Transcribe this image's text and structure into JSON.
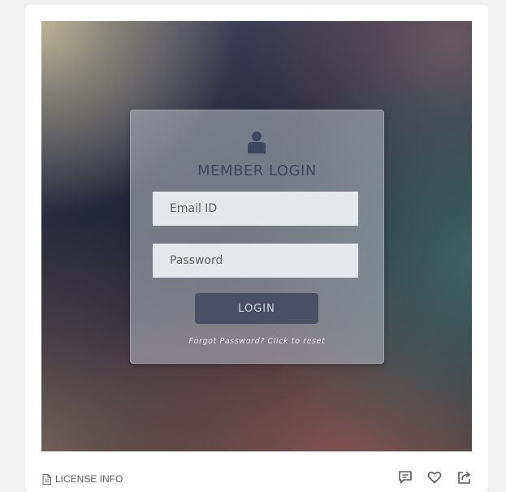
{
  "preview": {
    "panel": {
      "title": "MEMBER LOGIN",
      "email_placeholder": "Email ID",
      "password_placeholder": "Password",
      "login_label": "LOGIN",
      "forgot_text": "Forgot Password? Click to reset"
    }
  },
  "footer": {
    "license_label": "LICENSE INFO",
    "icons": [
      "comment-icon",
      "heart-icon",
      "share-icon"
    ]
  },
  "colors": {
    "panel_title": "#3f4660",
    "login_button": "#4c4e63",
    "field_bg": "#e6e7ea",
    "footer_text": "#5c5c5c",
    "footer_icon": "#5b5b5b"
  }
}
